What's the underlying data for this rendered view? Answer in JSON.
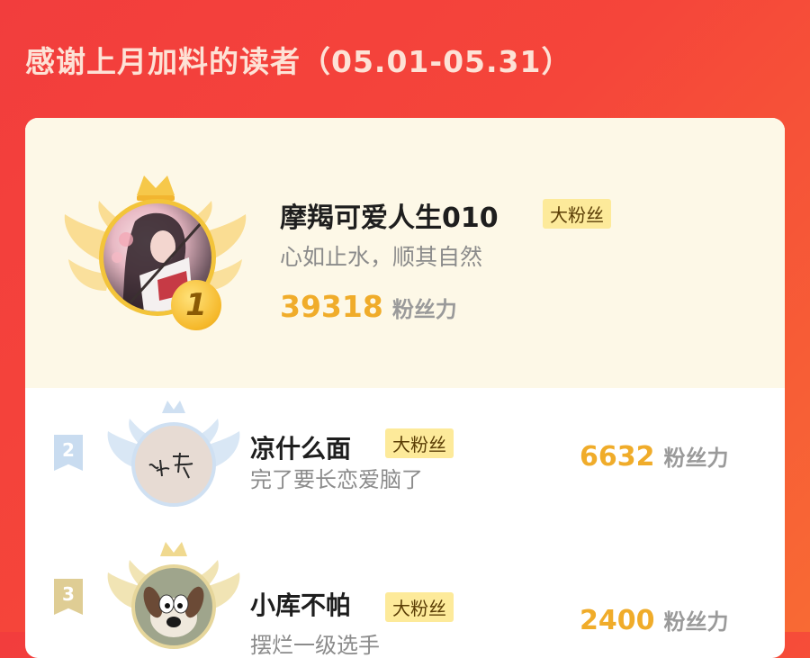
{
  "header": {
    "title": "感谢上月加料的读者（05.01-05.31）"
  },
  "colors": {
    "background_start": "#f23d3d",
    "background_end": "#f86a34",
    "gold": "#f0ac2a",
    "tag_bg": "#fdea9a"
  },
  "fans": [
    {
      "rank": "1",
      "name": "摩羯可爱人生010",
      "tag": "大粉丝",
      "bio": "心如止水，顺其自然",
      "score": "39318",
      "unit": "粉丝力",
      "avatar_icon": "anime-character-avatar"
    },
    {
      "rank": "2",
      "name": "凉什么面",
      "tag": "大粉丝",
      "bio": "完了要长恋爱脑了",
      "score": "6632",
      "unit": "粉丝力",
      "avatar_icon": "handwriting-avatar"
    },
    {
      "rank": "3",
      "name": "小库不帕",
      "tag": "大粉丝",
      "bio": "摆烂一级选手",
      "score": "2400",
      "unit": "粉丝力",
      "avatar_icon": "dog-avatar"
    }
  ]
}
